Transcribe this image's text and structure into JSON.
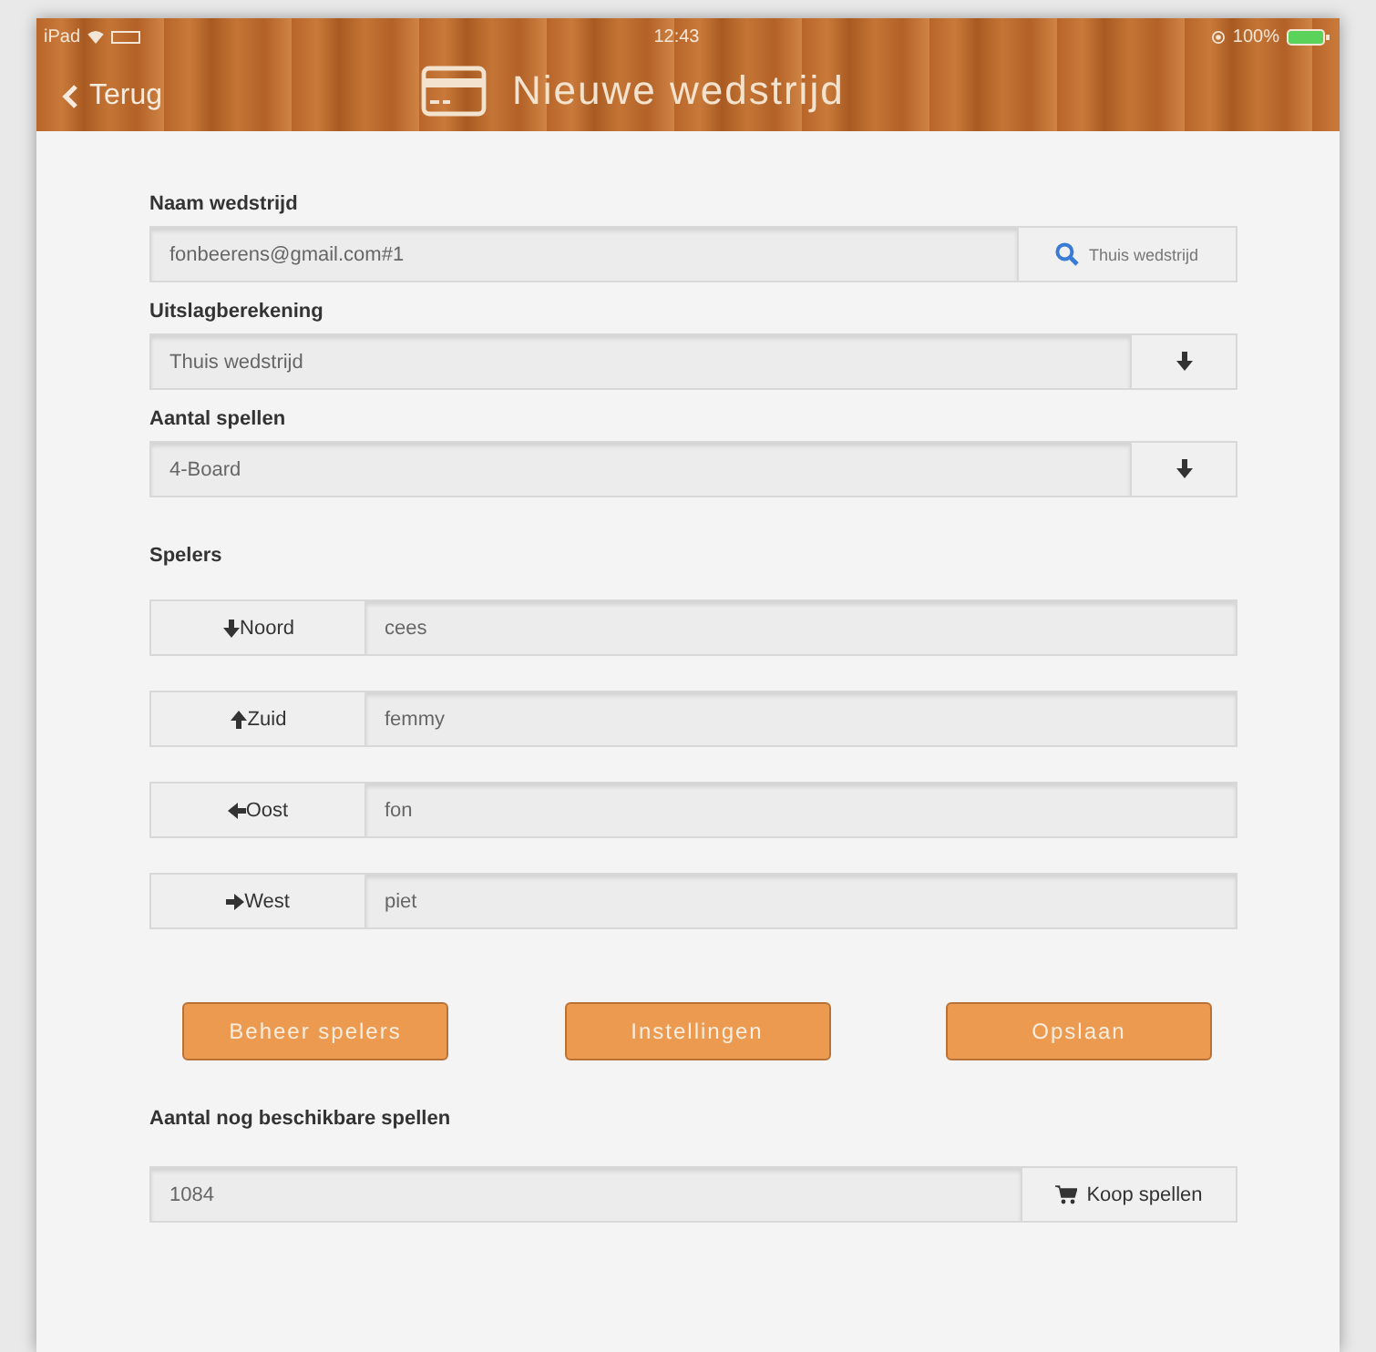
{
  "status_bar": {
    "device": "iPad",
    "time": "12:43",
    "battery": "100%"
  },
  "nav": {
    "back": "Terug",
    "title": "Nieuwe wedstrijd"
  },
  "fields": [
    {
      "label": "Naam wedstrijd",
      "value": "fonbeerens@gmail.com#1",
      "kind": "search",
      "addon": "Thuis wedstrijd"
    },
    {
      "label": "Uitslagberekening",
      "value": "Thuis wedstrijd",
      "kind": "select"
    },
    {
      "label": "Aantal spellen",
      "value": "4-Board",
      "kind": "select"
    }
  ],
  "players": {
    "label": "Spelers",
    "rows": [
      {
        "position": "Noord",
        "kind": "down",
        "name": "cees"
      },
      {
        "position": "Zuid",
        "kind": "up",
        "name": "femmy"
      },
      {
        "position": "Oost",
        "kind": "left",
        "name": "fon"
      },
      {
        "position": "West",
        "kind": "right",
        "name": "piet"
      }
    ]
  },
  "buttons": [
    "Beheer spelers",
    "Instellingen",
    "Opslaan"
  ],
  "remaining": {
    "label": "Aantal nog beschikbare spellen",
    "value": "1084",
    "action": "Koop spellen"
  }
}
